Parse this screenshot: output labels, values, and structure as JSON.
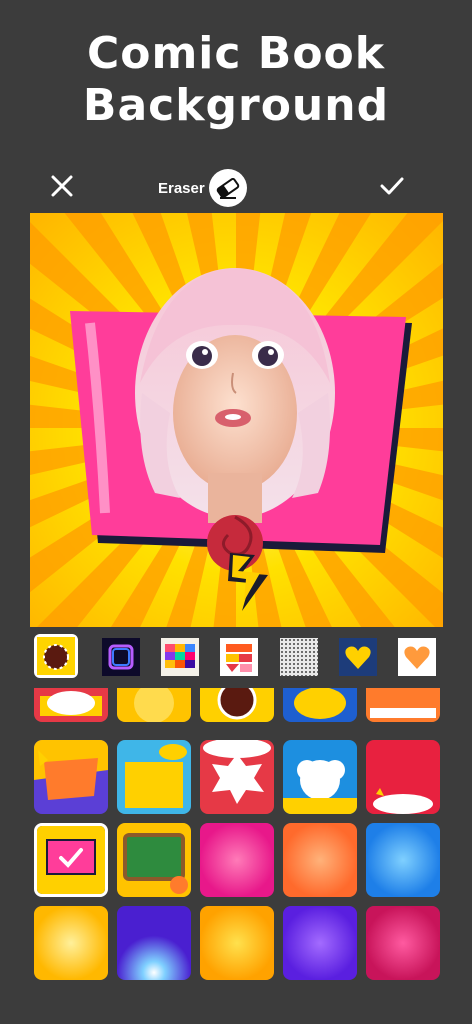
{
  "headline": {
    "line1": "Comic Book",
    "line2": "Background"
  },
  "toolbar": {
    "close_icon": "close-icon",
    "eraser_label": "Eraser",
    "eraser_icon": "eraser-icon",
    "confirm_icon": "checkmark-icon"
  },
  "thumbnails": [
    {
      "name": "comic-frame-burst",
      "selected": true
    },
    {
      "name": "neon-square-frame",
      "selected": false
    },
    {
      "name": "color-blocks",
      "selected": false
    },
    {
      "name": "red-orange-shapes",
      "selected": false
    },
    {
      "name": "halftone-pattern",
      "selected": false
    },
    {
      "name": "yellow-heart",
      "selected": false
    },
    {
      "name": "orange-heart",
      "selected": false
    }
  ],
  "grid_selected_index": 10,
  "colors": {
    "background": "#3c3c3c",
    "text": "#ffffff",
    "yellow": "#ffd500",
    "pink": "#ff3d9a"
  }
}
